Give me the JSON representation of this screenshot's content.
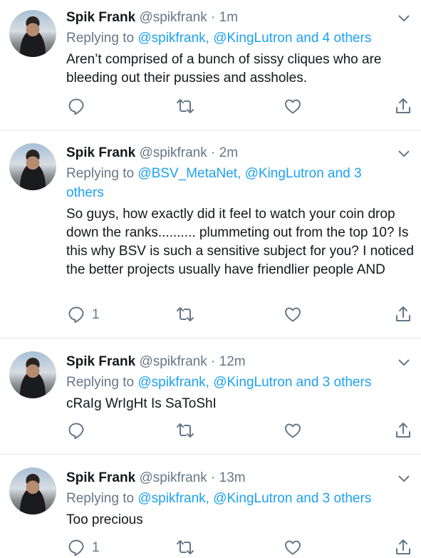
{
  "tweets": [
    {
      "name": "Spik Frank",
      "handle": "@spikfrank",
      "time": "1m",
      "replying_prefix": "Replying to",
      "replying_to": "@spikfrank, @KingLutron and 4 others",
      "text": "Aren’t comprised of a bunch of sissy cliques who are bleeding out their pussies and assholes.",
      "reply_count": ""
    },
    {
      "name": "Spik Frank",
      "handle": "@spikfrank",
      "time": "2m",
      "replying_prefix": "Replying to",
      "replying_to": "@BSV_MetaNet, @KingLutron and 3 others",
      "text": "So guys, how exactly did it feel to watch your coin drop down the ranks.......... plummeting out from the top 10? Is this why BSV is such a sensitive subject for you? I noticed the better projects usually have friendlier people AND",
      "reply_count": "1"
    },
    {
      "name": "Spik Frank",
      "handle": "@spikfrank",
      "time": "12m",
      "replying_prefix": "Replying to",
      "replying_to": "@spikfrank, @KingLutron and 3 others",
      "text": "cRaIg WrIgHt Is SaToShI",
      "reply_count": ""
    },
    {
      "name": "Spik Frank",
      "handle": "@spikfrank",
      "time": "13m",
      "replying_prefix": "Replying to",
      "replying_to": "@spikfrank, @KingLutron and 3 others",
      "text": "Too precious",
      "reply_count": "1"
    }
  ],
  "separator": "·",
  "icons": [
    "chevron-down-icon",
    "reply-icon",
    "retweet-icon",
    "like-icon",
    "share-icon"
  ],
  "colors": {
    "link": "#1da1f2",
    "secondary": "#657786",
    "divider": "#e1e8ed",
    "text": "#14171a"
  }
}
